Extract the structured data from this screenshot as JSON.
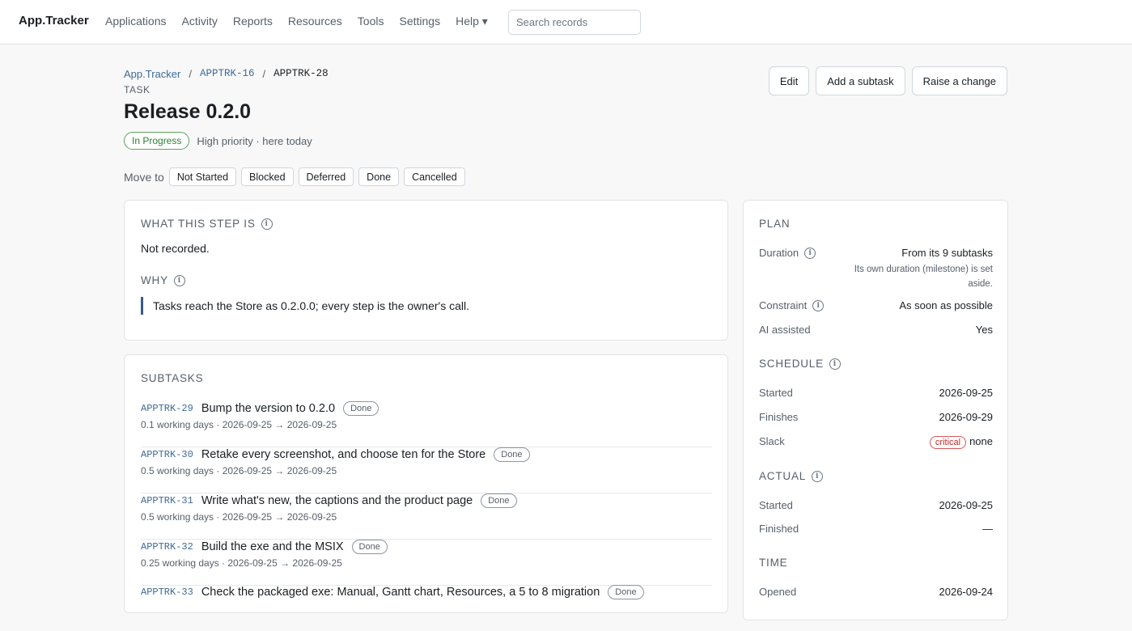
{
  "app": {
    "brand": "App.Tracker"
  },
  "nav": {
    "items": [
      "Applications",
      "Activity",
      "Reports",
      "Resources",
      "Tools",
      "Settings",
      "Help ▾"
    ],
    "search_placeholder": "Search records"
  },
  "breadcrumb": {
    "root": "App.Tracker",
    "parent": "APPTRK-16",
    "current": "APPTRK-28"
  },
  "page": {
    "kind": "TASK",
    "title": "Release 0.2.0",
    "status": "In Progress",
    "status_meta": "High priority · here today"
  },
  "actions": {
    "edit": "Edit",
    "add_subtask": "Add a subtask",
    "raise_change": "Raise a change"
  },
  "move_to": {
    "label": "Move to",
    "options": [
      "Not Started",
      "Blocked",
      "Deferred",
      "Done",
      "Cancelled"
    ]
  },
  "what": {
    "title": "WHAT THIS STEP IS",
    "value": "Not recorded.",
    "why_title": "WHY",
    "why_value": "Tasks reach the Store as 0.2.0.0; every step is the owner's call."
  },
  "subtasks": {
    "title": "SUBTASKS",
    "items": [
      {
        "id": "APPTRK-29",
        "name": "Bump the version to 0.2.0",
        "status": "Done",
        "meta": "0.1 working days · 2026-09-25 → 2026-09-25"
      },
      {
        "id": "APPTRK-30",
        "name": "Retake every screenshot, and choose ten for the Store",
        "status": "Done",
        "meta": "0.5 working days · 2026-09-25 → 2026-09-25"
      },
      {
        "id": "APPTRK-31",
        "name": "Write what's new, the captions and the product page",
        "status": "Done",
        "meta": "0.5 working days · 2026-09-25 → 2026-09-25"
      },
      {
        "id": "APPTRK-32",
        "name": "Build the exe and the MSIX",
        "status": "Done",
        "meta": "0.25 working days · 2026-09-25 → 2026-09-25"
      },
      {
        "id": "APPTRK-33",
        "name": "Check the packaged exe: Manual, Gantt chart, Resources, a 5 to 8 migration",
        "status": "Done",
        "meta": ""
      }
    ]
  },
  "plan": {
    "title": "PLAN",
    "duration_label": "Duration",
    "duration_value": "From its 9 subtasks",
    "duration_note": "Its own duration (milestone) is set aside.",
    "constraint_label": "Constraint",
    "constraint_value": "As soon as possible",
    "ai_label": "AI assisted",
    "ai_value": "Yes"
  },
  "schedule": {
    "title": "SCHEDULE",
    "started_label": "Started",
    "started_value": "2026-09-25",
    "finishes_label": "Finishes",
    "finishes_value": "2026-09-29",
    "slack_label": "Slack",
    "slack_badge": "critical",
    "slack_value": "none"
  },
  "actual": {
    "title": "ACTUAL",
    "started_label": "Started",
    "started_value": "2026-09-25",
    "finished_label": "Finished",
    "finished_value": "—"
  },
  "time": {
    "title": "TIME",
    "opened_label": "Opened",
    "opened_value": "2026-09-24"
  }
}
